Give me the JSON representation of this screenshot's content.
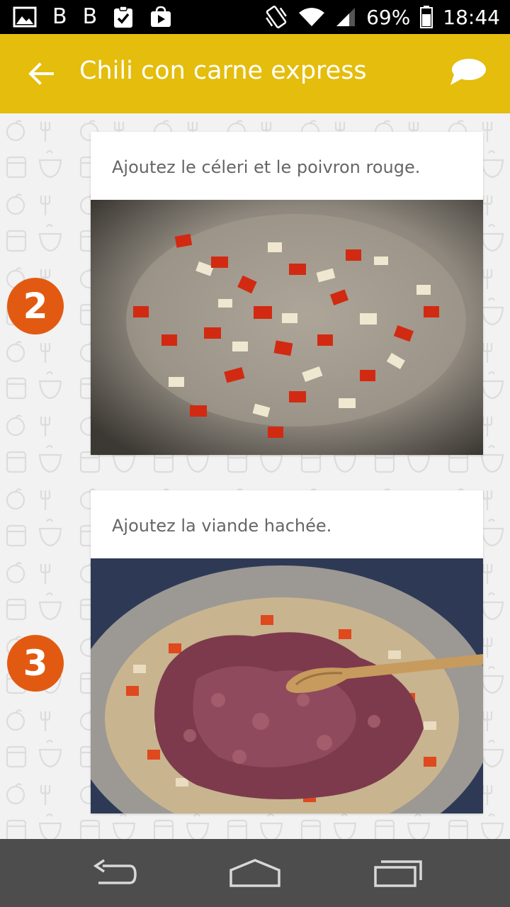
{
  "status_bar": {
    "battery_percent": "69%",
    "time": "18:44",
    "notification_letter": "B",
    "icons": [
      "image-icon",
      "b-app-icon",
      "b-app-icon",
      "clipboard-check-icon",
      "play-store-icon"
    ],
    "right_icons": [
      "vibrate-icon",
      "wifi-icon",
      "signal-icon",
      "battery-icon"
    ]
  },
  "app_bar": {
    "title": "Chili con carne express",
    "background": "#e4bd0d",
    "back_icon": "arrow-left-icon",
    "comment_icon": "comment-icon"
  },
  "steps": [
    {
      "number": "2",
      "text": "Ajoutez le céleri et le poivron rouge.",
      "photo": "celery-and-red-pepper-in-pan"
    },
    {
      "number": "3",
      "text": "Ajoutez la viande hachée.",
      "photo": "ground-meat-with-wooden-spoon"
    }
  ],
  "colors": {
    "step_badge": "#e25a12",
    "nav_bar": "#4d4d4d"
  },
  "nav_bar": {
    "buttons": [
      "back-icon",
      "home-icon",
      "recents-icon"
    ]
  }
}
